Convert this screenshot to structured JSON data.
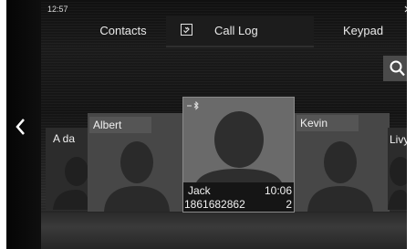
{
  "status": {
    "time": "12:57",
    "bluetooth_icon": "bluetooth-icon"
  },
  "tabs": {
    "contacts": "Contacts",
    "call_log": "Call Log",
    "keypad": "Keypad",
    "active": "call_log"
  },
  "icons": {
    "search": "search-icon",
    "back": "chevron-left-icon",
    "call_log": "phone-icon"
  },
  "cards": [
    {
      "name": "A da"
    },
    {
      "name": "Albert"
    },
    {
      "name": "Jack",
      "time": "10:06",
      "number": "1861682862",
      "count": "2",
      "selected": true
    },
    {
      "name": "Kevin"
    },
    {
      "name": "Livy"
    }
  ],
  "colors": {
    "background": "#141414",
    "tab_active": "#1c1c1c",
    "search_button": "#4a4a4a"
  }
}
